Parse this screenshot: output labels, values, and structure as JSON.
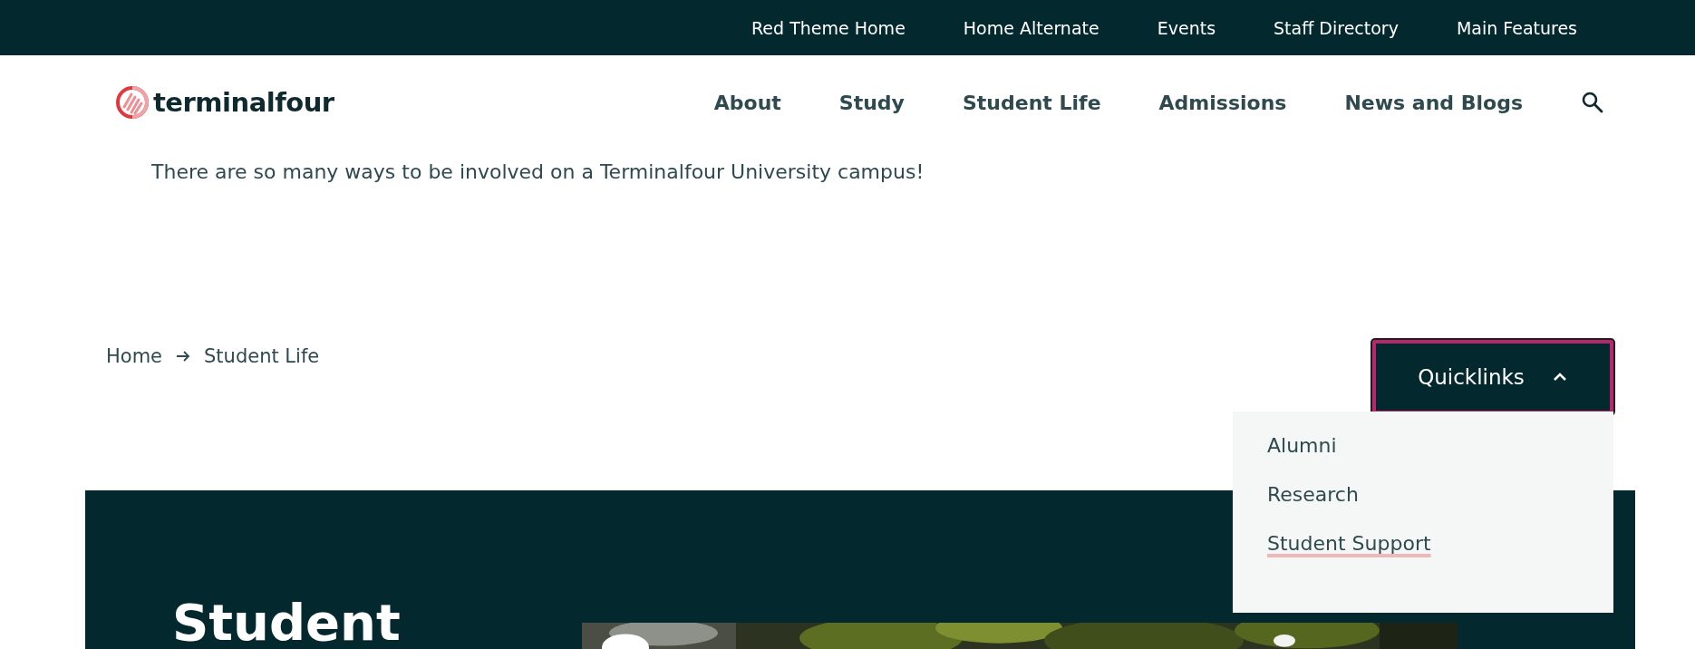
{
  "top_bar": {
    "links": [
      "Red Theme Home",
      "Home Alternate",
      "Events",
      "Staff Directory",
      "Main Features"
    ]
  },
  "header": {
    "logo": "terminalfour",
    "nav": [
      "About",
      "Study",
      "Student Life",
      "Admissions",
      "News and Blogs"
    ]
  },
  "intro": "There are so many ways to be involved on a Terminalfour University campus!",
  "breadcrumb": [
    "Home",
    "Student Life"
  ],
  "quicklinks": {
    "label": "Quicklinks",
    "expanded": true,
    "items": [
      {
        "label": "Alumni",
        "selected": false
      },
      {
        "label": "Research",
        "selected": false
      },
      {
        "label": "Student Support",
        "selected": true
      }
    ]
  },
  "feature": {
    "heading": "Student"
  }
}
